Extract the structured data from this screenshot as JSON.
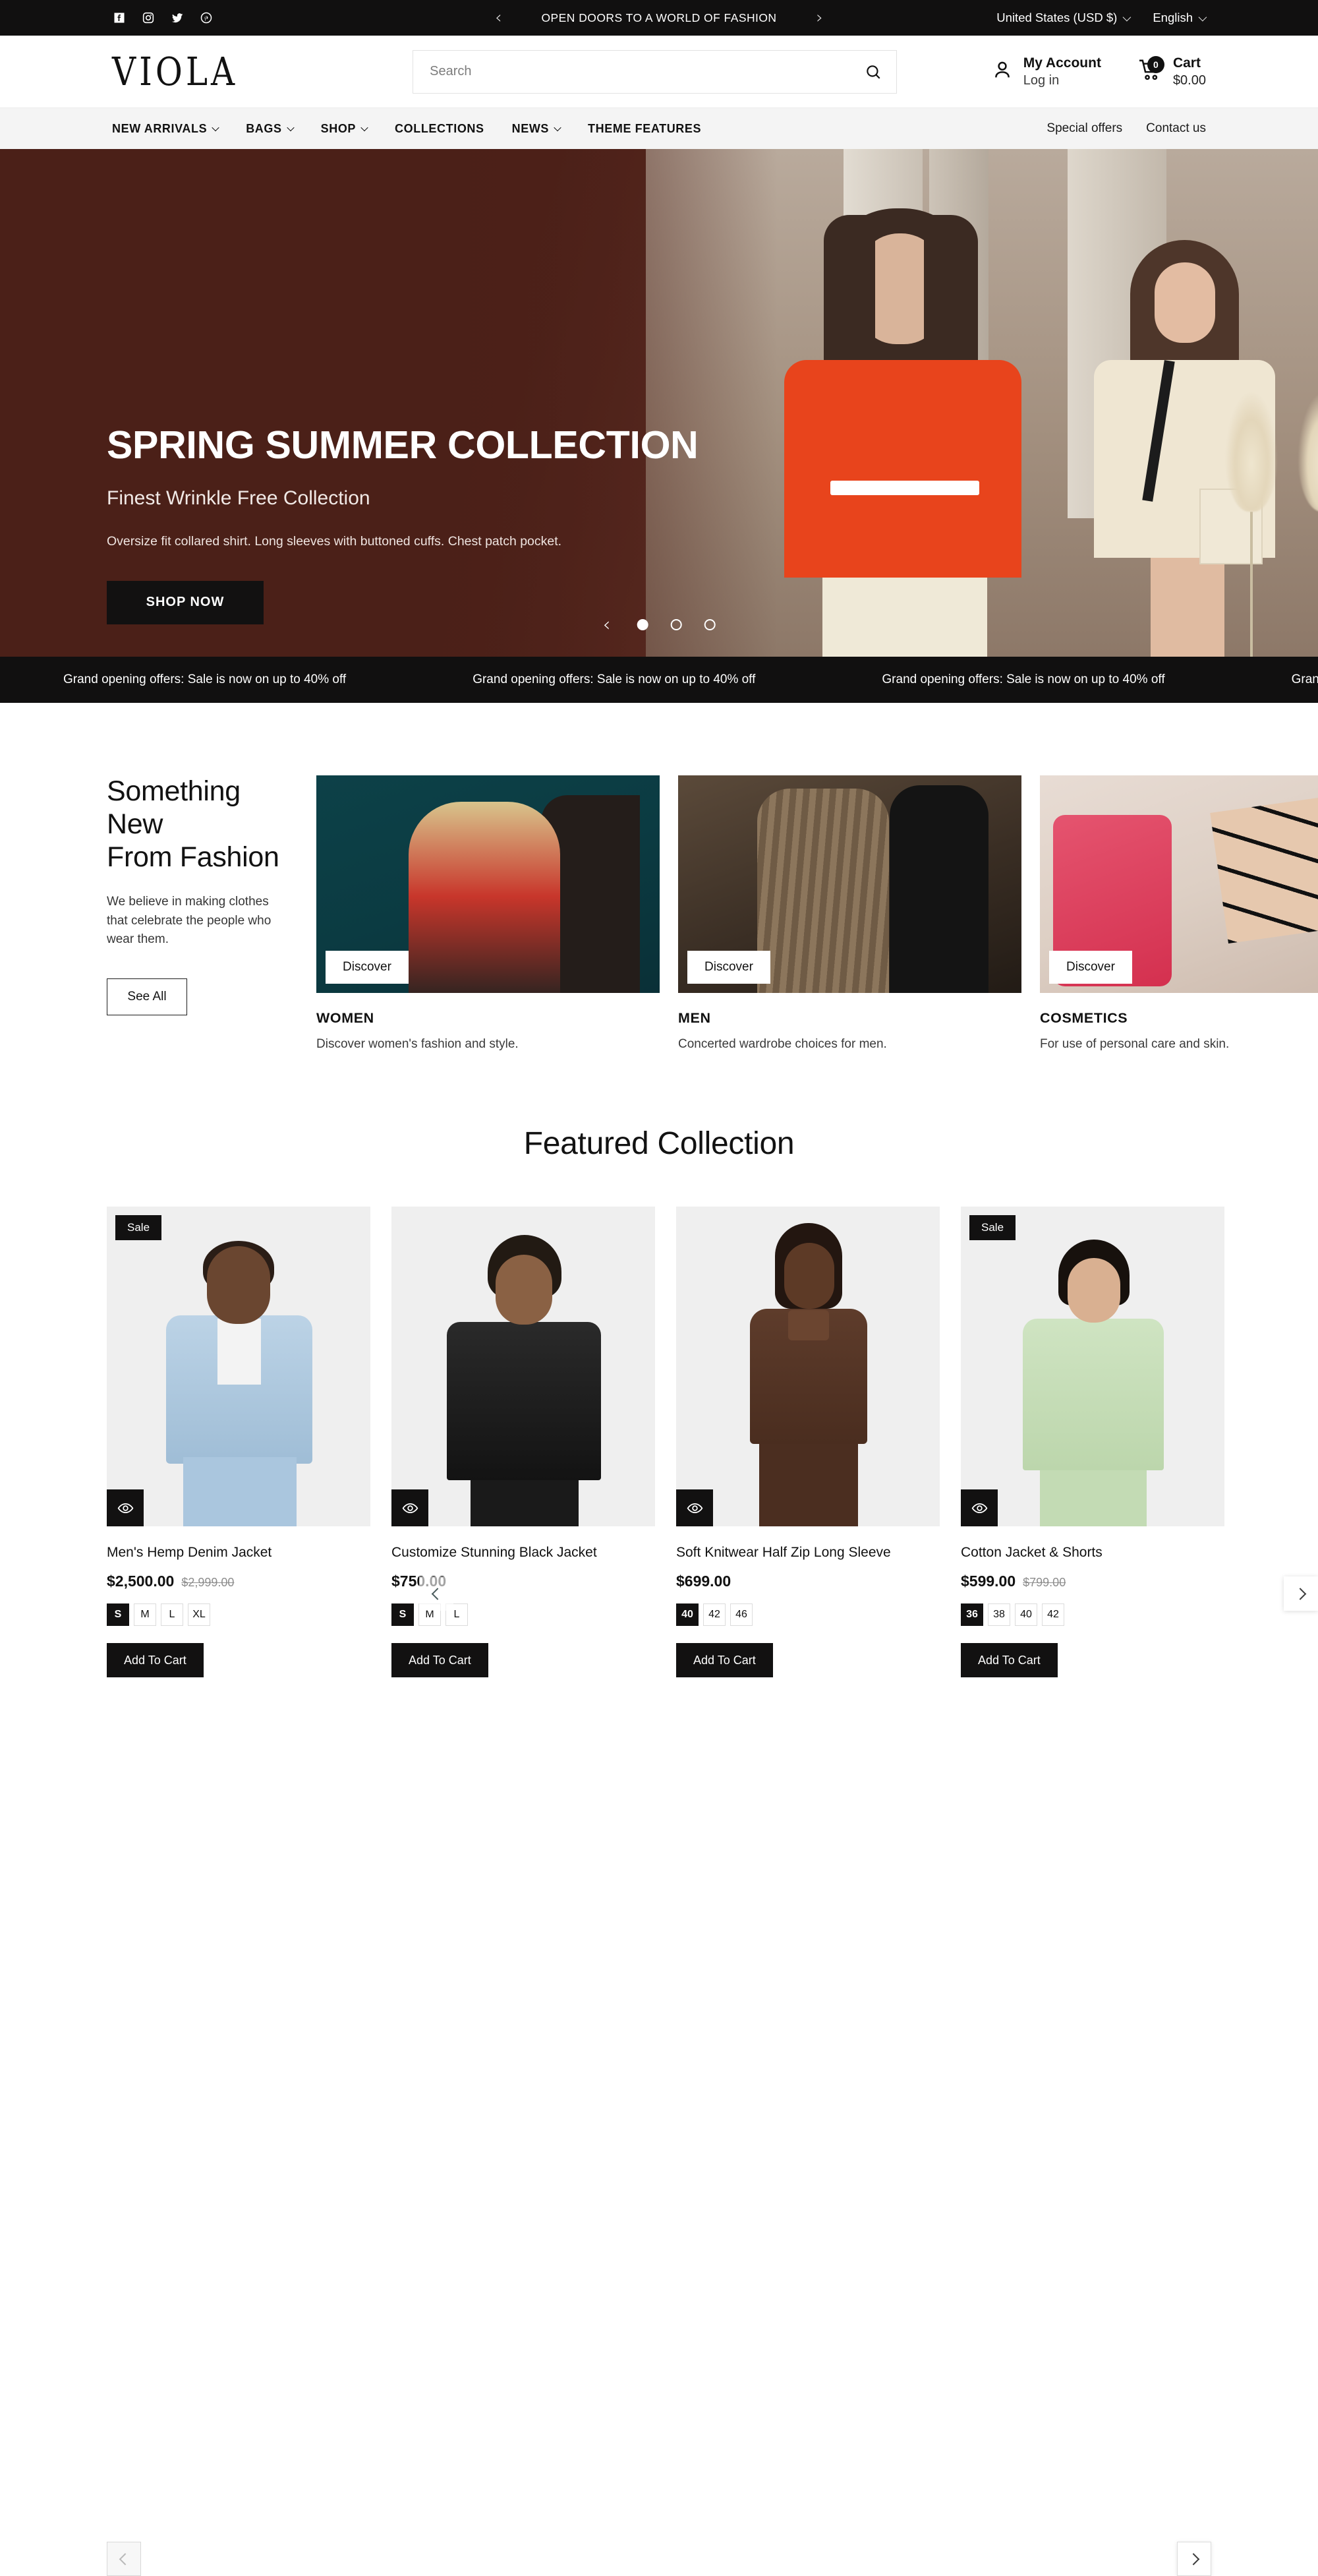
{
  "topbar": {
    "social": [
      {
        "name": "facebook-icon",
        "label": "Facebook"
      },
      {
        "name": "instagram-icon",
        "label": "Instagram"
      },
      {
        "name": "twitter-icon",
        "label": "Twitter"
      },
      {
        "name": "pinterest-icon",
        "label": "Pinterest"
      }
    ],
    "announcement": "OPEN DOORS TO A WORLD OF FASHION",
    "prev_label": "‹",
    "next_label": "›",
    "country": "United States (USD $)",
    "language": "English"
  },
  "header": {
    "logo": "VIOLA",
    "search_placeholder": "Search",
    "search_value": "",
    "account_title": "My Account",
    "account_sub": "Log in",
    "cart_title": "Cart",
    "cart_total": "$0.00",
    "cart_count": "0"
  },
  "nav": {
    "items": [
      {
        "label": "NEW ARRIVALS",
        "has_caret": true
      },
      {
        "label": "BAGS",
        "has_caret": true
      },
      {
        "label": "SHOP",
        "has_caret": true
      },
      {
        "label": "COLLECTIONS",
        "has_caret": false
      },
      {
        "label": "NEWS",
        "has_caret": true
      },
      {
        "label": "THEME FEATURES",
        "has_caret": false
      }
    ],
    "right_links": [
      "Special offers",
      "Contact us"
    ]
  },
  "hero": {
    "title": "SPRING SUMMER COLLECTION",
    "subtitle": "Finest Wrinkle Free Collection",
    "description": "Oversize fit collared shirt. Long sleeves with buttoned cuffs. Chest patch pocket.",
    "cta": "SHOP NOW",
    "prev_label": "‹",
    "slide_count": 3,
    "active_slide": 1,
    "bg_color": "#4b2018"
  },
  "marquee": {
    "text": "Grand opening offers: Sale is now on up to 40% off",
    "repeats": 6
  },
  "categories": {
    "heading_line1": "Something New",
    "heading_line2": "From Fashion",
    "paragraph": "We believe in making clothes that celebrate the people who wear them.",
    "see_all": "See All",
    "discover_label": "Discover",
    "cards": [
      {
        "name": "WOMEN",
        "desc": "Discover women's fashion and style.",
        "class": "ci-women"
      },
      {
        "name": "MEN",
        "desc": "Concerted wardrobe choices for men.",
        "class": "ci-men"
      },
      {
        "name": "COSMETICS",
        "desc": "For use of personal care and skin.",
        "class": "ci-cos"
      }
    ]
  },
  "featured": {
    "title": "Featured Collection",
    "add_to_cart": "Add To Cart",
    "sale_label": "Sale",
    "products": [
      {
        "title": "Men's Hemp Denim Jacket",
        "price": "$2,500.00",
        "compare_at": "$2,999.00",
        "on_sale": true,
        "sizes": [
          "S",
          "M",
          "L",
          "XL"
        ],
        "selected_size": "S",
        "fig": "p1"
      },
      {
        "title": "Customize Stunning Black Jacket",
        "price": "$750.00",
        "compare_at": "",
        "on_sale": false,
        "sizes": [
          "S",
          "M",
          "L"
        ],
        "selected_size": "S",
        "fig": "p2"
      },
      {
        "title": "Soft Knitwear Half Zip Long Sleeve",
        "price": "$699.00",
        "compare_at": "",
        "on_sale": false,
        "sizes": [
          "40",
          "42",
          "46"
        ],
        "selected_size": "40",
        "fig": "p3"
      },
      {
        "title": "Cotton Jacket & Shorts",
        "price": "$599.00",
        "compare_at": "$799.00",
        "on_sale": true,
        "sizes": [
          "36",
          "38",
          "40",
          "42"
        ],
        "selected_size": "36",
        "fig": "p4"
      }
    ]
  }
}
